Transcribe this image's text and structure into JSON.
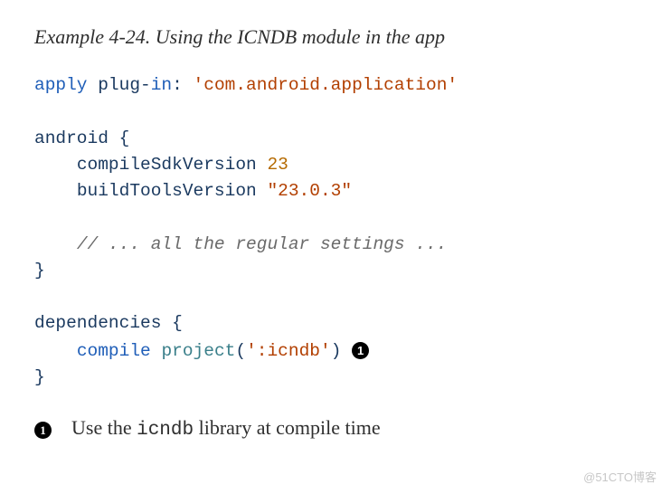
{
  "title": "Example 4-24. Using the ICNDB module in the app",
  "code": {
    "l1_kw1": "apply",
    "l1_kw2": "plug",
    "l1_kw3": "in",
    "l1_str": "'com.android.application'",
    "l3_kw": "android",
    "l4_prop": "compileSdkVersion",
    "l4_num": "23",
    "l5_prop": "buildToolsVersion",
    "l5_str": "\"23.0.3\"",
    "l7_cmt": "// ... all the regular settings ...",
    "l10_kw": "dependencies",
    "l11_kw": "compile",
    "l11_fn": "project",
    "l11_arg": "':icndb'"
  },
  "callouts": {
    "num1": "1",
    "text1_pre": "Use the ",
    "text1_code": "icndb",
    "text1_post": " library at compile time"
  },
  "watermark": "@51CTO博客"
}
